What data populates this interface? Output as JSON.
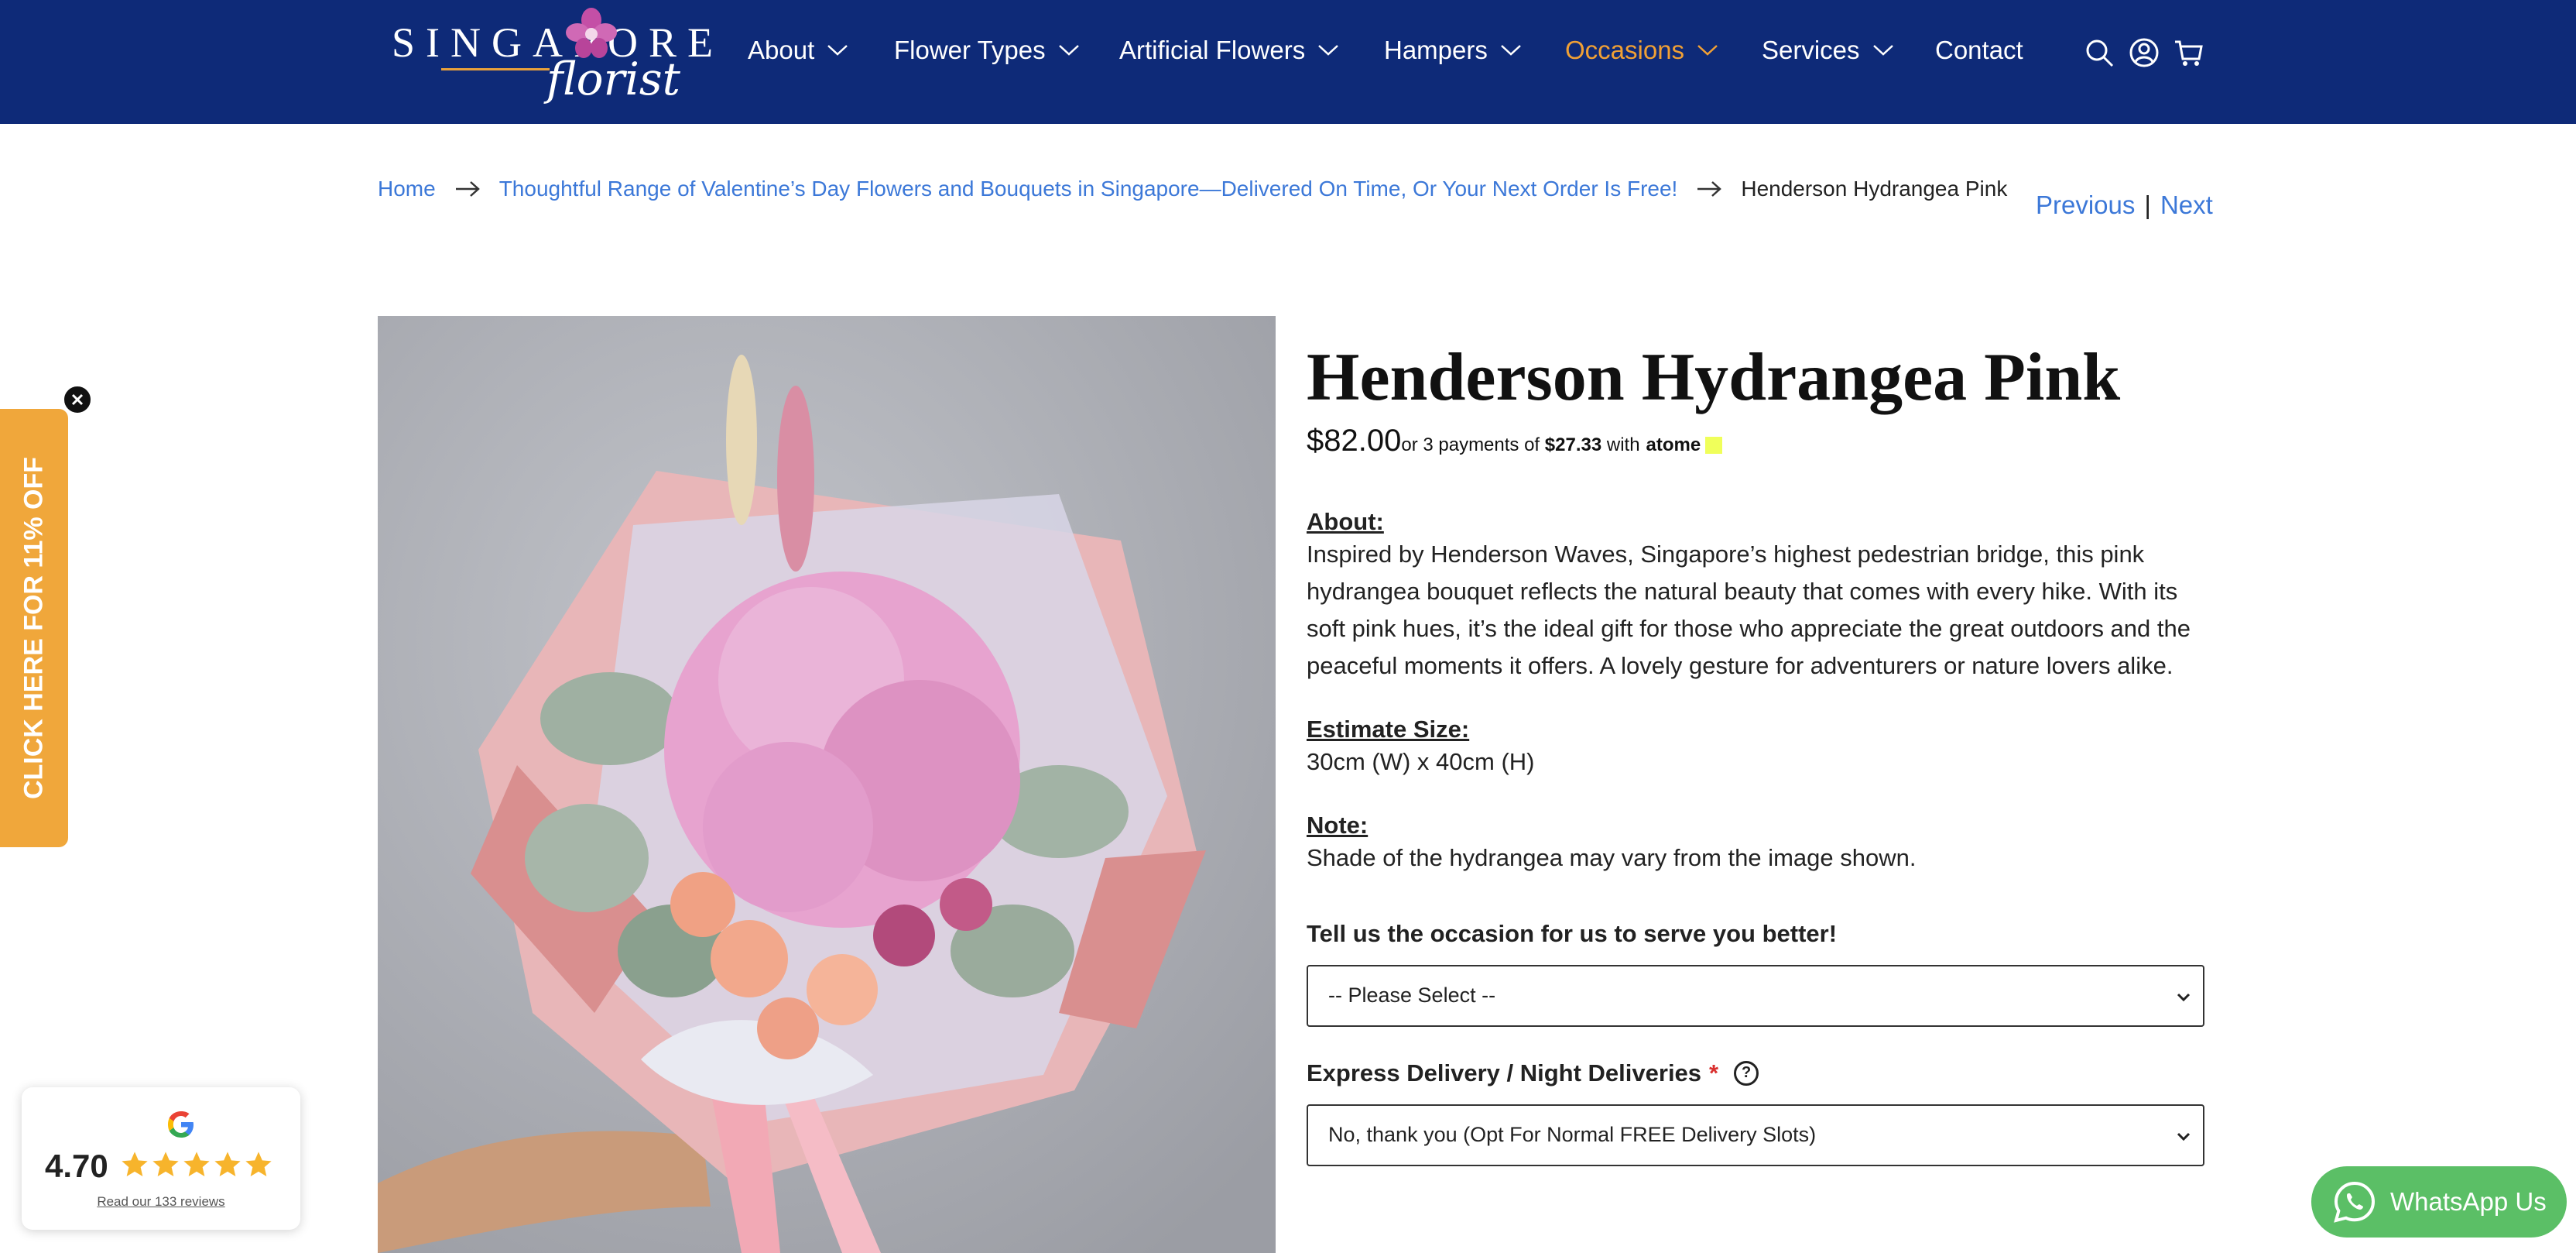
{
  "header": {
    "logo_word": "SINGAPORE",
    "logo_script": "florist",
    "nav": [
      {
        "label": "About",
        "active": false
      },
      {
        "label": "Flower Types",
        "active": false
      },
      {
        "label": "Artificial Flowers",
        "active": false
      },
      {
        "label": "Hampers",
        "active": false
      },
      {
        "label": "Occasions",
        "active": true
      },
      {
        "label": "Services",
        "active": false
      },
      {
        "label": "Contact",
        "active": false
      }
    ],
    "icons": [
      "search-icon",
      "account-icon",
      "cart-icon"
    ],
    "colors": {
      "background": "#0e2a78",
      "active": "#f0a035"
    }
  },
  "breadcrumb": {
    "home": "Home",
    "category": "Thoughtful Range of Valentine’s Day Flowers and Bouquets in Singapore—Delivered On Time, Or Your Next Order Is Free!",
    "current": "Henderson Hydrangea Pink"
  },
  "pager": {
    "previous": "Previous",
    "separator": "|",
    "next": "Next"
  },
  "product": {
    "title": "Henderson Hydrangea Pink",
    "price": "$82.00",
    "installment_prefix": "or 3 payments of",
    "installment_amount": "$27.33",
    "installment_with": "with",
    "installment_brand": "atome",
    "about_heading": "About:",
    "about_text": "Inspired by Henderson Waves, Singapore’s highest pedestrian bridge, this pink hydrangea bouquet reflects the natural beauty that comes with every hike. With its soft pink hues, it’s the ideal gift for those who appreciate the great outdoors and the peaceful moments it offers. A lovely gesture for adventurers or nature lovers alike.",
    "size_heading": "Estimate Size:",
    "size_text": "30cm (W) x 40cm (H)",
    "note_heading": "Note:",
    "note_text": "Shade of the hydrangea may vary from the image shown."
  },
  "form": {
    "occasion_label": "Tell us the occasion for us to serve you better!",
    "occasion_value": "-- Please Select --",
    "delivery_label": "Express Delivery / Night Deliveries",
    "delivery_required": "*",
    "delivery_help": "?",
    "delivery_value": "No, thank you (Opt For Normal FREE Delivery Slots)"
  },
  "promo": {
    "label": "CLICK HERE FOR 11% OFF",
    "color": "#f0a73b"
  },
  "reviews": {
    "score": "4.70",
    "rating": 5,
    "max": 5,
    "link": "Read our 133 reviews"
  },
  "whatsapp": {
    "label": "WhatsApp Us",
    "color": "#5bbf66"
  }
}
